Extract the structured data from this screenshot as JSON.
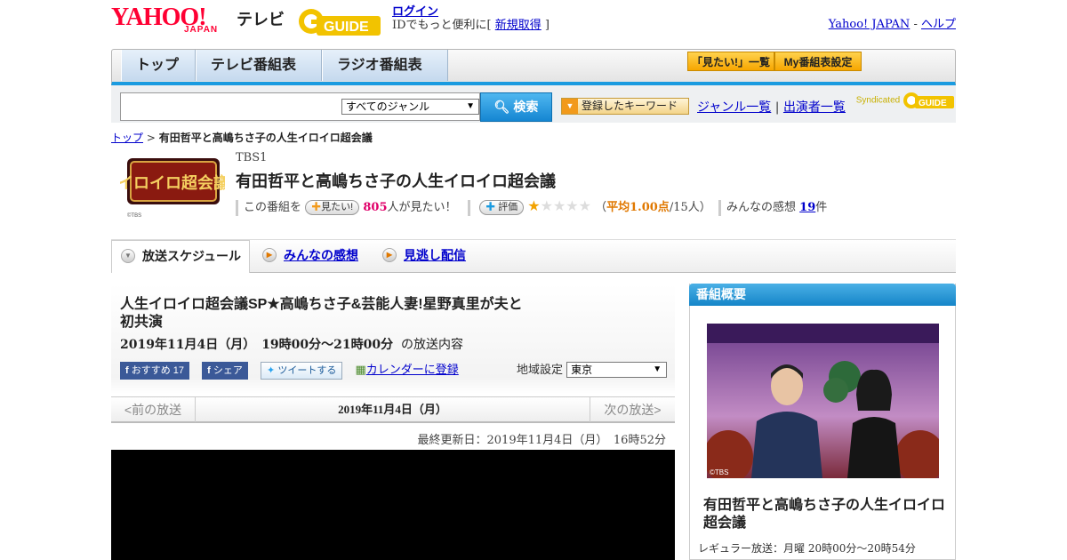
{
  "header": {
    "logo_text": "YAHOO!",
    "logo_sub": "JAPAN",
    "service": "テレビ",
    "gguide_logo": "G-GUIDE",
    "login": "ログイン",
    "login_sub_prefix": "IDでもっと便利に[ ",
    "signup": "新規取得",
    "login_sub_suffix": " ]",
    "yahoo_japan": "Yahoo! JAPAN",
    "sep": " - ",
    "help": "ヘルプ"
  },
  "nav": {
    "tabs": [
      "トップ",
      "テレビ番組表",
      "ラジオ番組表"
    ],
    "mitai_list": "「見たい!」一覧",
    "my_schedule": "My番組表設定"
  },
  "search": {
    "genre": "すべてのジャンル",
    "button": "検索",
    "keyword_button": "登録したキーワード",
    "genre_list": "ジャンル一覧",
    "divider": "|",
    "performer_list": "出演者一覧",
    "syndicated": "Syndicated"
  },
  "breadcrumb": {
    "top": "トップ",
    "sep": " > ",
    "current": "有田哲平と高嶋ちさ子の人生イロイロ超会議"
  },
  "program": {
    "logo_text": "イロイロ超会議",
    "logo_credit": "©TBS",
    "channel": "TBS1",
    "title": "有田哲平と高嶋ちさ子の人生イロイロ超会議",
    "prefix": "この番組を",
    "mitai_btn": "見たい!",
    "mitai_count": "805",
    "mitai_suffix": "人が見たい！",
    "rate_btn": "評価",
    "stars_on": "★",
    "stars_off": "★★★★",
    "avg_open": "（",
    "avg": "平均1.00点",
    "avg_rest": "/15人）",
    "impressions_label": "みんなの感想",
    "impressions_count": "19",
    "impressions_suffix": "件"
  },
  "subtabs": {
    "schedule": "放送スケジュール",
    "impressions": "みんなの感想",
    "missed": "見逃し配信"
  },
  "episode": {
    "title": "人生イロイロ超会議SP★高嶋ちさ子&芸能人妻!星野真里が夫と初共演",
    "date": "2019年11月4日（月）　19時00分～21時00分",
    "date_suffix": "の放送内容",
    "fb_recommend": "おすすめ 17",
    "fb_share": "シェア",
    "tweet": "ツイートする",
    "calendar": "カレンダーに登録",
    "area_label": "地域設定",
    "area_value": "東京",
    "prev": "<前の放送",
    "current_date": "2019年11月4日（月）",
    "next": "次の放送>",
    "updated": "最終更新日：2019年11月4日（月）　16時52分"
  },
  "sidebar": {
    "heading": "番組概要",
    "image_credit": "©TBS",
    "title": "有田哲平と高嶋ちさ子の人生イロイロ超会議",
    "regular": "レギュラー放送：月曜 20時00分～20時54分"
  },
  "colors": {
    "accent_blue": "#1a9be0",
    "yahoo_red": "#ff0033",
    "mitai_magenta": "#e0006a",
    "rating_orange": "#e07800"
  }
}
